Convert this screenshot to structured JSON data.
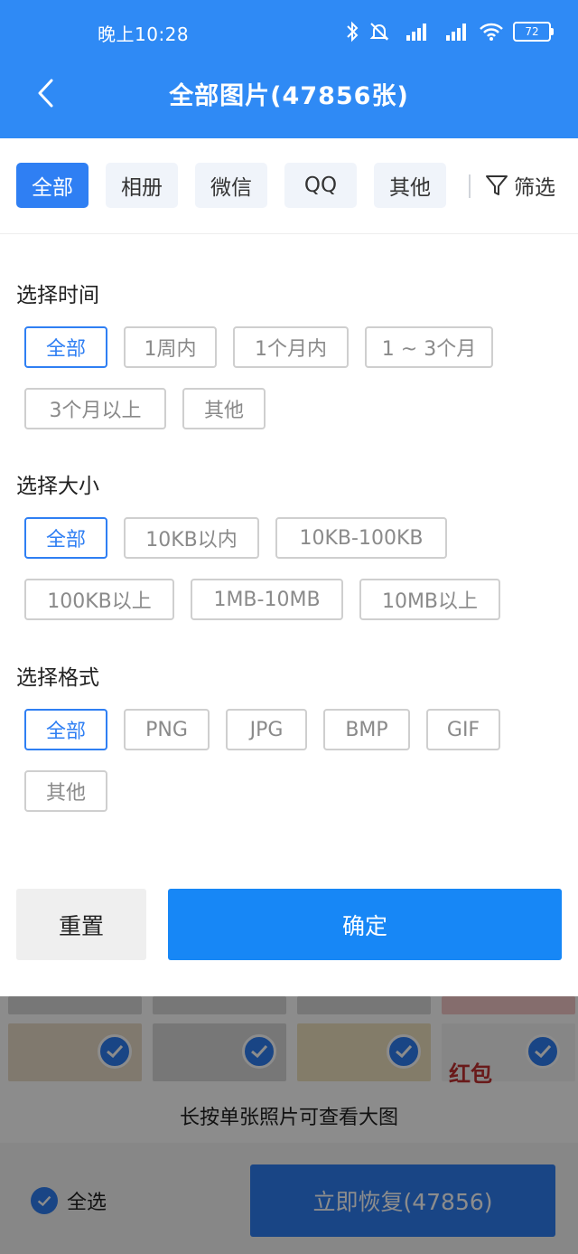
{
  "status_bar": {
    "time": "晚上10:28",
    "battery": "72"
  },
  "header": {
    "title": "全部图片(47856张)"
  },
  "tabs": [
    {
      "label": "全部",
      "active": true
    },
    {
      "label": "相册",
      "active": false
    },
    {
      "label": "微信",
      "active": false
    },
    {
      "label": "QQ",
      "active": false
    },
    {
      "label": "其他",
      "active": false
    }
  ],
  "filter_label": "筛选",
  "sections": {
    "time": {
      "title": "选择时间",
      "options": [
        "全部",
        "1周内",
        "1个月内",
        "1 ~ 3个月",
        "3个月以上",
        "其他"
      ],
      "selected": "全部"
    },
    "size": {
      "title": "选择大小",
      "options": [
        "全部",
        "10KB以内",
        "10KB-100KB",
        "100KB以上",
        "1MB-10MB",
        "10MB以上"
      ],
      "selected": "全部"
    },
    "format": {
      "title": "选择格式",
      "options": [
        "全部",
        "PNG",
        "JPG",
        "BMP",
        "GIF",
        "其他"
      ],
      "selected": "全部"
    }
  },
  "actions": {
    "reset": "重置",
    "confirm": "确定"
  },
  "background": {
    "thumb_caption": "红包",
    "hint": "长按单张照片可查看大图",
    "select_all": "全选",
    "recover": "立即恢复(47856)"
  },
  "colors": {
    "primary": "#2f8af5",
    "confirm": "#1787f6",
    "selected": "#2f7ff3"
  }
}
